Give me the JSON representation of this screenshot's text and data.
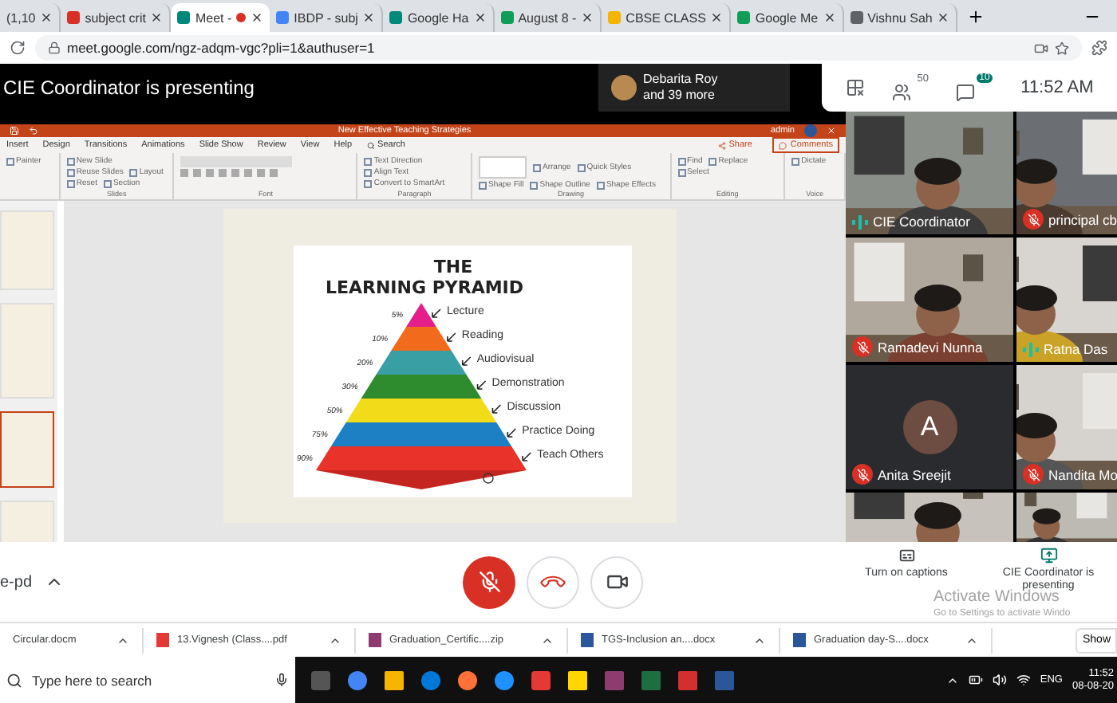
{
  "browser": {
    "tabs": [
      {
        "label": "(1,10",
        "selected": false,
        "recording": false
      },
      {
        "label": "subject crit",
        "kind": "mail",
        "selected": false,
        "recording": false
      },
      {
        "label": "Meet -",
        "kind": "meet",
        "selected": true,
        "recording": true
      },
      {
        "label": "IBDP - subj",
        "kind": "docs",
        "selected": false,
        "recording": false
      },
      {
        "label": "Google Ha",
        "kind": "meet",
        "selected": false,
        "recording": false
      },
      {
        "label": "August 8 -",
        "kind": "sheets",
        "selected": false,
        "recording": false
      },
      {
        "label": "CBSE CLASS",
        "kind": "drive",
        "selected": false,
        "recording": false
      },
      {
        "label": "Google Me",
        "kind": "sheets",
        "selected": false,
        "recording": false
      },
      {
        "label": "Vishnu Sah",
        "kind": "other",
        "selected": false,
        "recording": false
      }
    ],
    "address": "meet.google.com/ngz-adqm-vgc?pli=1&authuser=1"
  },
  "meet_header": {
    "title": "CIE Coordinator is presenting",
    "participant": "Debarita Roy",
    "more": "and 39 more",
    "people_count": "50",
    "chat_badge": "10",
    "time": "11:52 AM"
  },
  "powerpoint": {
    "title": "New Effective Teaching Strategies",
    "user": "admin",
    "ribbon_tabs": [
      {
        "label": "Insert",
        "selected": false
      },
      {
        "label": "Design",
        "selected": false
      },
      {
        "label": "Transitions",
        "selected": false
      },
      {
        "label": "Animations",
        "selected": false
      },
      {
        "label": "Slide Show",
        "selected": false
      },
      {
        "label": "Review",
        "selected": false
      },
      {
        "label": "View",
        "selected": false
      },
      {
        "label": "Help",
        "selected": false
      }
    ],
    "search": "Search",
    "share": "Share",
    "comments": "Comments",
    "groups": [
      {
        "kind": "buttons",
        "items": [
          "Painter"
        ]
      },
      {
        "kind": "buttons",
        "label": "Slides",
        "items": [
          "New Slide",
          "Reuse Slides",
          "Layout",
          "Reset",
          "Section"
        ]
      },
      {
        "kind": "font",
        "label": "Font"
      },
      {
        "kind": "buttons",
        "label": "Paragraph",
        "items": [
          "Text Direction",
          "Align Text",
          "Convert to SmartArt"
        ]
      },
      {
        "kind": "shapes",
        "label": "Drawing",
        "items": [
          "Arrange",
          "Quick Styles",
          "Shape Fill",
          "Shape Outline",
          "Shape Effects"
        ]
      },
      {
        "kind": "buttons",
        "label": "Editing",
        "items": [
          "Find",
          "Replace",
          "Select"
        ]
      },
      {
        "kind": "buttons",
        "label": "Voice",
        "items": [
          "Dictate"
        ]
      }
    ]
  },
  "slide": {
    "title_top": "THE",
    "title_bottom": "LEARNING PYRAMID",
    "levels": [
      {
        "percent": "5%",
        "label": "Lecture",
        "color": "#e41f8c"
      },
      {
        "percent": "10%",
        "label": "Reading",
        "color": "#f26a1b"
      },
      {
        "percent": "20%",
        "label": "Audiovisual",
        "color": "#3a9ea5"
      },
      {
        "percent": "30%",
        "label": "Demonstration",
        "color": "#2e8b2e"
      },
      {
        "percent": "50%",
        "label": "Discussion",
        "color": "#f2dc1a"
      },
      {
        "percent": "75%",
        "label": "Practice Doing",
        "color": "#1d7fc4"
      },
      {
        "percent": "90%",
        "label": "Teach Others",
        "color": "#e8322a"
      }
    ]
  },
  "participants": [
    {
      "name": "CIE Coordinator",
      "muted": false,
      "kind": "video"
    },
    {
      "name": "principal cb",
      "muted": true,
      "kind": "video"
    },
    {
      "name": "Ramadevi Nunna",
      "muted": true,
      "kind": "video"
    },
    {
      "name": "Ratna Das",
      "muted": false,
      "kind": "video"
    },
    {
      "name": "Anita Sreejit",
      "muted": true,
      "kind": "avatar",
      "initial": "A"
    },
    {
      "name": "Nandita Mo",
      "muted": true,
      "kind": "video"
    }
  ],
  "controls": {
    "meeting": "e-pd",
    "mic_muted": true,
    "captions": "Turn on captions",
    "presenting": "CIE Coordinator is presenting"
  },
  "downloads": {
    "items": [
      {
        "name": "Circular.docm"
      },
      {
        "name": "13.Vignesh (Class....pdf",
        "kind": "pdf"
      },
      {
        "name": "Graduation_Certific....zip",
        "kind": "zip"
      },
      {
        "name": "TGS-Inclusion an....docx",
        "kind": "word"
      },
      {
        "name": "Graduation day-S....docx",
        "kind": "word"
      }
    ],
    "show": "Show"
  },
  "taskbar": {
    "search": "Type here to search",
    "language": "ENG",
    "time": "11:52",
    "date": "08-08-20"
  },
  "activation": {
    "title": "Activate Windows",
    "hint": "Go to Settings to activate Windo"
  }
}
